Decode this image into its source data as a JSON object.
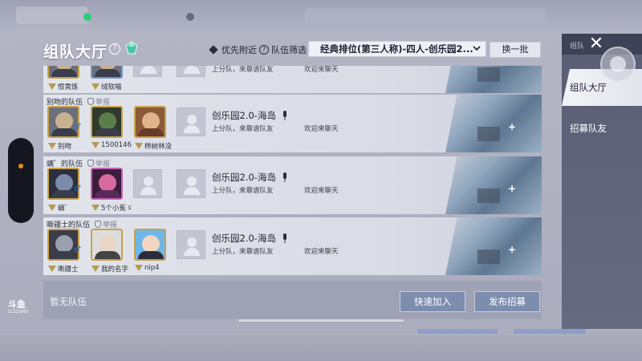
{
  "header": {
    "title": "组队大厅",
    "priority_label": "优先附近",
    "filter_label": "队伍筛选",
    "filter_value": "经典排位(第三人称)-四人-创乐园2...",
    "refresh_label": "换一批"
  },
  "teams": [
    {
      "name": "",
      "members": [
        {
          "name": "恨霄炼",
          "gender": ""
        },
        {
          "name": "绒软喵",
          "gender": ""
        }
      ],
      "room_name": "",
      "desc": "上分队，来靠谱队友",
      "chat": "欢迎来聊天"
    },
    {
      "name": "别吻的队伍",
      "report": "举报",
      "members": [
        {
          "name": "别吻",
          "gender": "♂"
        },
        {
          "name": "1500146",
          "gender": ""
        },
        {
          "name": "柿树林没",
          "gender": ""
        }
      ],
      "room_name": "创乐园2.0-海岛",
      "desc": "上分队，来靠谱队友",
      "chat": "欢迎来聊天"
    },
    {
      "name": "螭゛的队伍",
      "report": "举报",
      "members": [
        {
          "name": "螭゛",
          "gender": "♂"
        },
        {
          "name": "5个小菟ゞ",
          "gender": ""
        }
      ],
      "room_name": "创乐园2.0-海岛",
      "desc": "上分队，来靠谱队友",
      "chat": "欢迎来聊天"
    },
    {
      "name": "嘶疆士的队伍",
      "report": "举报",
      "members": [
        {
          "name": "嘶疆士",
          "gender": "♂"
        },
        {
          "name": "我的名字",
          "gender": ""
        },
        {
          "name": "nip4",
          "gender": ""
        }
      ],
      "room_name": "创乐园2.0-海岛",
      "desc": "上分队，来靠谱队友",
      "chat": "欢迎来聊天"
    }
  ],
  "footer": {
    "no_team": "暂无队伍",
    "quick_join": "快速加入",
    "publish": "发布招募"
  },
  "sidebar": {
    "top_label": "组队",
    "tabs": [
      {
        "label": "组队大厅",
        "active": true
      },
      {
        "label": "招募队友",
        "active": false
      }
    ]
  },
  "logo": {
    "text": "斗鱼",
    "sub": "11211093"
  },
  "icons": {
    "help": "help-icon",
    "gem": "gem-icon",
    "mic": "mic-icon",
    "close": "close-icon",
    "report": "shield-icon"
  },
  "colors": {
    "accent_button": "#7d8dae",
    "sidebar": "#5a5e74",
    "active_tab": "#f2f3f8"
  }
}
